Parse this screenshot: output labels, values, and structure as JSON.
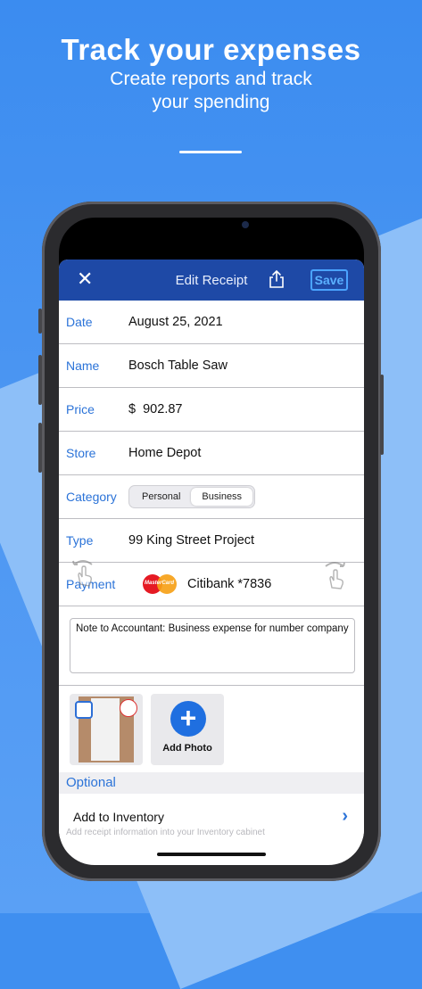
{
  "hero": {
    "title": "Track your expenses",
    "subtitle_line1": "Create reports and track",
    "subtitle_line2": "your spending"
  },
  "navbar": {
    "close_glyph": "✕",
    "title": "Edit Receipt",
    "share_icon": "share-icon",
    "save_label": "Save"
  },
  "form": {
    "date": {
      "label": "Date",
      "value": "August 25, 2021"
    },
    "name": {
      "label": "Name",
      "value": "Bosch Table Saw"
    },
    "price": {
      "label": "Price",
      "value": "$  902.87"
    },
    "store": {
      "label": "Store",
      "value": "Home Depot"
    },
    "category": {
      "label": "Category",
      "options": [
        "Personal",
        "Business"
      ],
      "selected": "Business"
    },
    "type": {
      "label": "Type",
      "value": "99 King Street Project"
    },
    "payment": {
      "label": "Payment",
      "card_brand": "MasterCard",
      "value": "Citibank *7836"
    }
  },
  "note": "Note to Accountant: Business expense for number company",
  "photos": {
    "add_label": "Add Photo"
  },
  "optional": {
    "header": "Optional",
    "inventory_label": "Add to Inventory",
    "inventory_hint": "Add receipt information into your Inventory cabinet"
  },
  "colors": {
    "background": "#3f8ff0",
    "navbar": "#1e49a6",
    "accent": "#2b73d8"
  }
}
